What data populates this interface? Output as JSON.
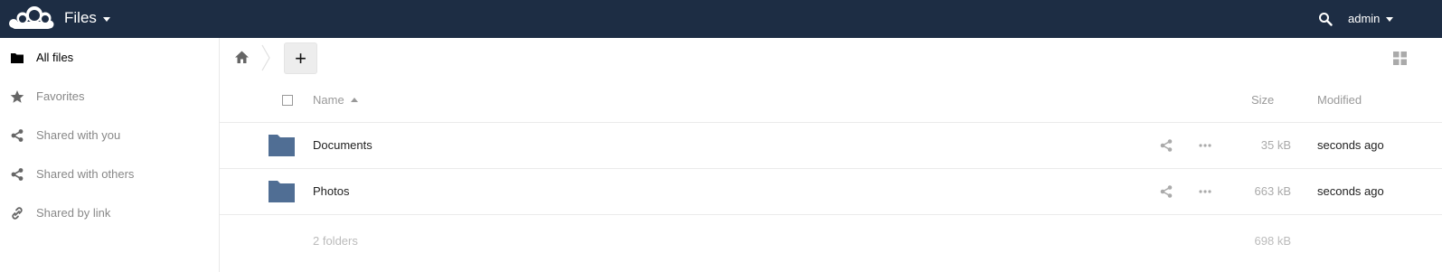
{
  "header": {
    "app_name": "Files",
    "user": "admin",
    "colors": {
      "bar": "#1d2d44",
      "text": "#ffffff"
    }
  },
  "sidebar": {
    "items": [
      {
        "label": "All files",
        "icon": "folder-icon",
        "active": true
      },
      {
        "label": "Favorites",
        "icon": "star-icon",
        "active": false
      },
      {
        "label": "Shared with you",
        "icon": "share-icon",
        "active": false
      },
      {
        "label": "Shared with others",
        "icon": "share-icon",
        "active": false
      },
      {
        "label": "Shared by link",
        "icon": "link-icon",
        "active": false
      }
    ]
  },
  "controls": {
    "new_label": "+"
  },
  "table": {
    "columns": {
      "name": "Name",
      "size": "Size",
      "modified": "Modified"
    },
    "rows": [
      {
        "name": "Documents",
        "size": "35 kB",
        "modified": "seconds ago",
        "type": "folder"
      },
      {
        "name": "Photos",
        "size": "663 kB",
        "modified": "seconds ago",
        "type": "folder"
      }
    ],
    "summary": {
      "count": "2 folders",
      "size": "698 kB"
    }
  },
  "colors": {
    "folder": "#506e94",
    "accent": "#1d2d44"
  }
}
